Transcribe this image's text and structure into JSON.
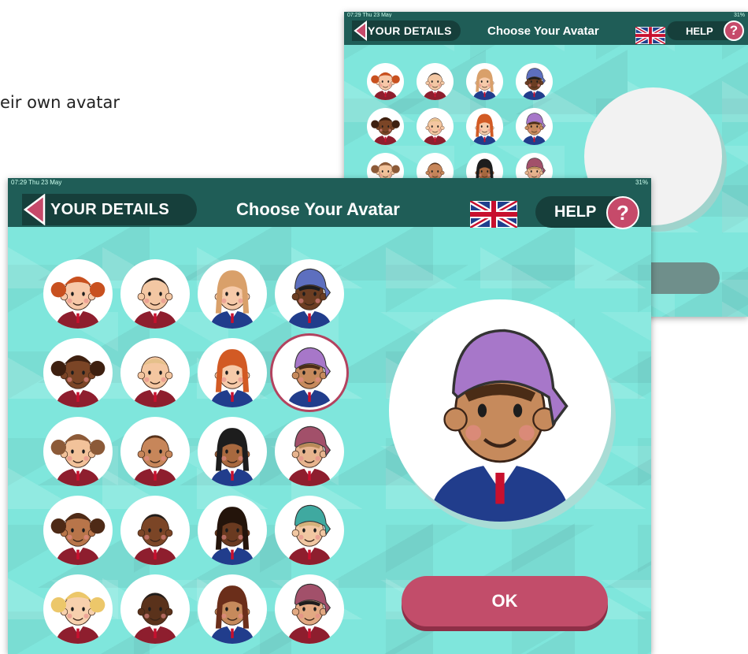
{
  "caption": "eir own avatar",
  "status": {
    "time": "07:29",
    "date": "Thu 23 May",
    "battery": "31%"
  },
  "header": {
    "back_label": "YOUR DETAILS",
    "title": "Choose Your Avatar",
    "help_label": "HELP",
    "help_icon": "?"
  },
  "ok_label": "OK",
  "back_ok_label": "OK",
  "selected_index": 7,
  "colors": {
    "topbar": "#1f5d57",
    "background": "#7fe6dc",
    "accent": "#c24d6a"
  },
  "avatars": [
    {
      "skin": "#f7c8a8",
      "hair": "#c8501f",
      "style": "pigtails",
      "uniform": "#8e1e2e"
    },
    {
      "skin": "#f3c7a3",
      "hair": "#1d1d1d",
      "style": "short",
      "uniform": "#8e1e2e"
    },
    {
      "skin": "#f6caa9",
      "hair": "#d9a06a",
      "style": "long",
      "uniform": "#213d8c"
    },
    {
      "skin": "#6b3d22",
      "hair": "#1d1d1d",
      "style": "cap",
      "cap": "#5d6fbf",
      "uniform": "#213d8c"
    },
    {
      "skin": "#7b4526",
      "hair": "#3e2010",
      "style": "pigtails",
      "uniform": "#8e1e2e"
    },
    {
      "skin": "#f4c6a0",
      "hair": "#e5c08a",
      "style": "bald",
      "uniform": "#8e1e2e"
    },
    {
      "skin": "#f6caa9",
      "hair": "#d25a24",
      "style": "long",
      "uniform": "#213d8c"
    },
    {
      "skin": "#c68a5c",
      "hair": "#4a2c16",
      "style": "cap",
      "cap": "#a777c9",
      "uniform": "#213d8c"
    },
    {
      "skin": "#f2c29a",
      "hair": "#8c5a38",
      "style": "pigtails",
      "uniform": "#8e1e2e"
    },
    {
      "skin": "#c7865a",
      "hair": "#5a3219",
      "style": "short",
      "uniform": "#8e1e2e"
    },
    {
      "skin": "#a8693f",
      "hair": "#1d1d1d",
      "style": "long",
      "uniform": "#213d8c"
    },
    {
      "skin": "#e7b48e",
      "hair": "#b98a58",
      "style": "cap",
      "cap": "#a2506a",
      "uniform": "#8e1e2e"
    },
    {
      "skin": "#b8754a",
      "hair": "#4e2a16",
      "style": "pigtails",
      "uniform": "#8e1e2e"
    },
    {
      "skin": "#7b4526",
      "hair": "#1d1d1d",
      "style": "short",
      "uniform": "#8e1e2e"
    },
    {
      "skin": "#6a3a20",
      "hair": "#24140b",
      "style": "long",
      "uniform": "#213d8c"
    },
    {
      "skin": "#f1c7a2",
      "hair": "#d4b27a",
      "style": "cap",
      "cap": "#3fa9a0",
      "uniform": "#8e1e2e"
    },
    {
      "skin": "#f7d0ad",
      "hair": "#ecc76a",
      "style": "pigtails",
      "uniform": "#8e1e2e"
    },
    {
      "skin": "#5a321b",
      "hair": "#1d1d1d",
      "style": "short",
      "uniform": "#8e1e2e"
    },
    {
      "skin": "#c68a5c",
      "hair": "#6b2e1a",
      "style": "long",
      "uniform": "#213d8c"
    },
    {
      "skin": "#e2a982",
      "hair": "#1d1d1d",
      "style": "cap",
      "cap": "#a2506a",
      "uniform": "#8e1e2e"
    }
  ]
}
